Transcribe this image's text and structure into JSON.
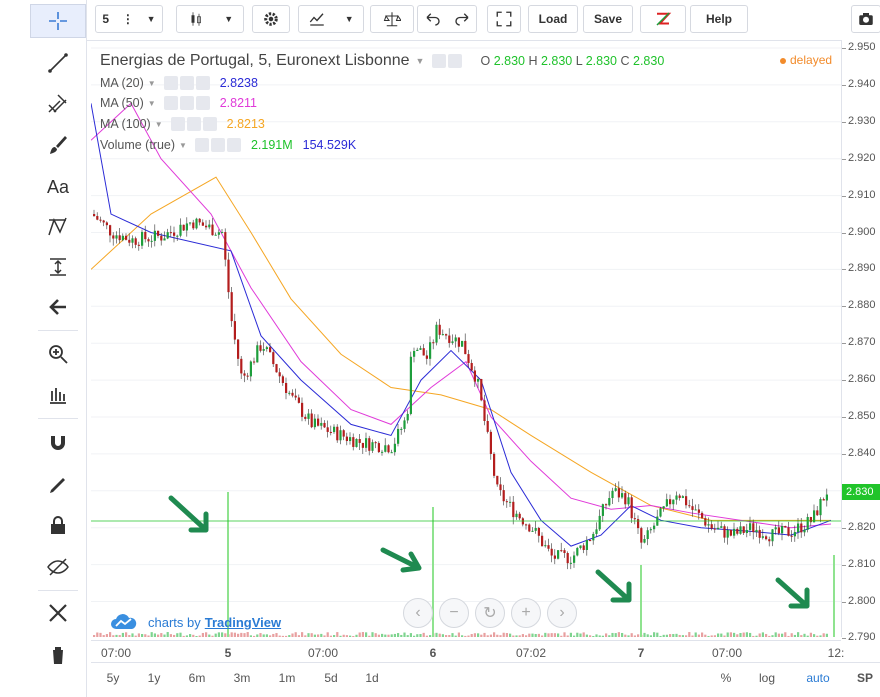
{
  "top_toolbar": {
    "interval": "5",
    "load_label": "Load",
    "save_label": "Save",
    "help_label": "Help"
  },
  "legend": {
    "symbol": "Energias de Portugal, 5, Euronext Lisbonne",
    "o_label": "O",
    "o": "2.830",
    "h_label": "H",
    "h": "2.830",
    "l_label": "L",
    "l": "2.830",
    "c_label": "C",
    "c": "2.830",
    "delayed": "delayed",
    "ma20_label": "MA (20)",
    "ma20": "2.8238",
    "ma20_color": "#2b2bd6",
    "ma50_label": "MA (50)",
    "ma50": "2.8211",
    "ma50_color": "#e03ad9",
    "ma100_label": "MA (100)",
    "ma100": "2.8213",
    "ma100_color": "#f5a623",
    "volume_label": "Volume (true)",
    "vol1": "2.191M",
    "vol2": "154.529K"
  },
  "price_axis": {
    "ticks": [
      "2.950",
      "2.940",
      "2.930",
      "2.920",
      "2.910",
      "2.900",
      "2.890",
      "2.880",
      "2.870",
      "2.860",
      "2.850",
      "2.840",
      "2.830",
      "2.820",
      "2.810",
      "2.800",
      "2.790"
    ],
    "last_price": "2.830"
  },
  "time_axis": {
    "ticks": [
      "07:00",
      "5",
      "07:00",
      "6",
      "07:02",
      "7",
      "07:00",
      "12:"
    ]
  },
  "bottom_bar": {
    "ranges": [
      "5y",
      "1y",
      "6m",
      "3m",
      "1m",
      "5d",
      "1d"
    ],
    "percent": "%",
    "log": "log",
    "auto": "auto",
    "sp": "SP"
  },
  "branding": {
    "prefix": "charts by",
    "name": "TradingView"
  },
  "colors": {
    "up": "#1e9e3c",
    "down": "#b31d1d",
    "accent": "#21c42a"
  }
}
